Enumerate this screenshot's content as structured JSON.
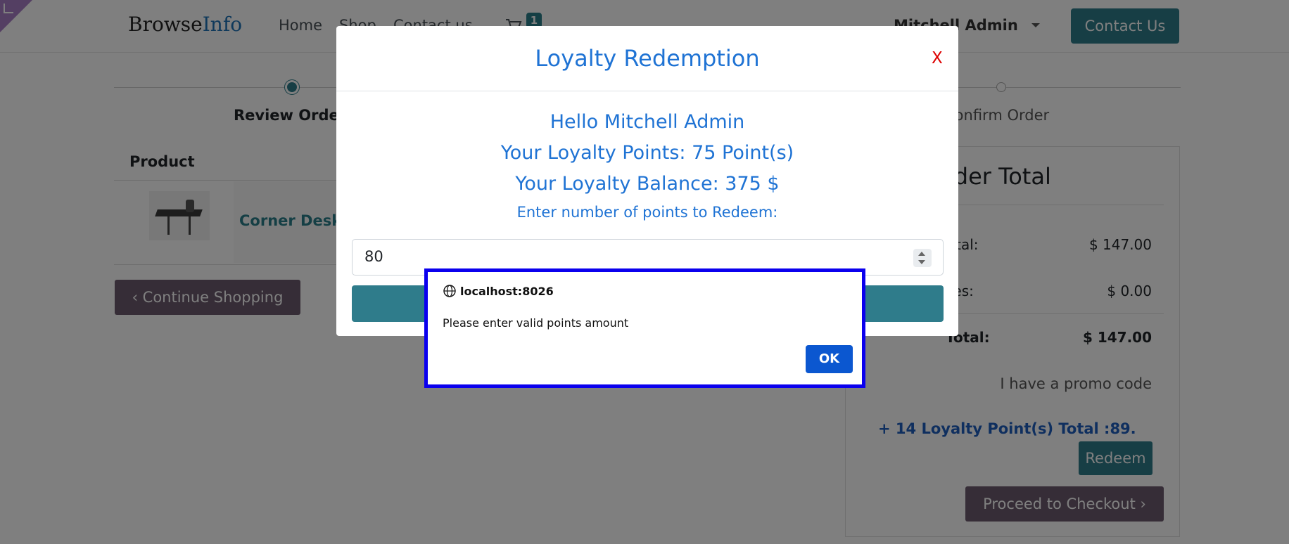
{
  "header": {
    "logo_part1": "Browse",
    "logo_part2": "Info",
    "nav": [
      "Home",
      "Shop",
      "Contact us"
    ],
    "cart_icon": "shopping-cart-icon",
    "cart_count": "1",
    "user_name": "Mitchell Admin",
    "contact_button": "Contact Us"
  },
  "steps": {
    "review": "Review Order",
    "confirm": "Confirm Order"
  },
  "cart_table": {
    "product_header": "Product",
    "rows": [
      {
        "name": "Corner Desk",
        "image_icon": "corner-desk-image"
      }
    ],
    "continue_button": "Continue Shopping"
  },
  "summary": {
    "title": "Order Total",
    "lines": [
      {
        "label": "Subtotal:",
        "value": "$ 147.00"
      },
      {
        "label": "Taxes:",
        "value": "$ 0.00"
      },
      {
        "label": "Total:",
        "value": "$ 147.00"
      }
    ],
    "promo": "I have a promo code",
    "loyalty_text": "+ 14 Loyalty Point(s) Total :89.",
    "redeem_button": "Redeem",
    "proceed_button": "Proceed to Checkout"
  },
  "loyalty_modal": {
    "title": "Loyalty Redemption",
    "close": "X",
    "greeting": "Hello  Mitchell Admin",
    "points": "Your Loyalty Points: 75 Point(s)",
    "balance": "Your Loyalty Balance:  375  $",
    "prompt": "Enter number of points to Redeem:",
    "input_value": "80"
  },
  "alert": {
    "host": "localhost:8026",
    "message": "Please enter valid points amount",
    "ok": "OK"
  },
  "colors": {
    "accent": "#2f7c8b",
    "modal_text": "#1f73d4",
    "alert_border": "#0b00ee",
    "ok_button": "#0b57d0",
    "secondary_button": "#6c5b6f"
  }
}
